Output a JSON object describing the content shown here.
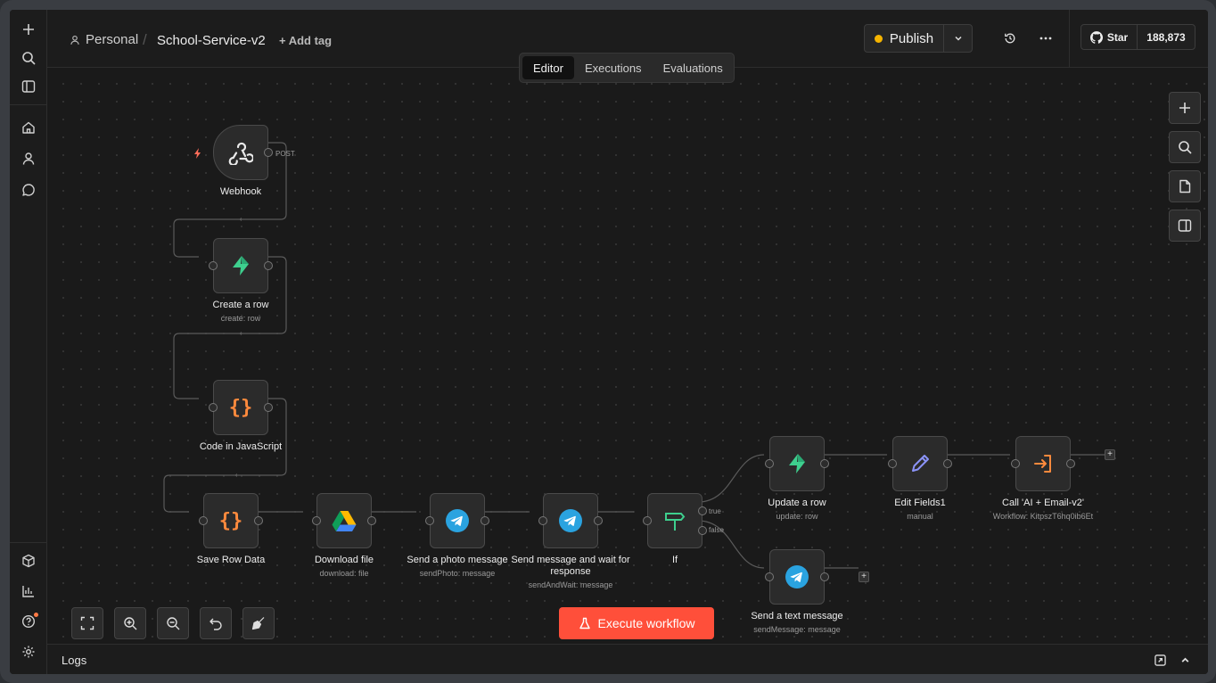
{
  "header": {
    "project": "Personal",
    "separator": "/",
    "workflow_name": "School-Service-v2",
    "add_tag": "+ Add tag",
    "publish_label": "Publish",
    "publish_status_color": "#f5b400",
    "github_star_label": "Star",
    "github_star_count": "188,873"
  },
  "tabs": [
    {
      "label": "Editor",
      "active": true
    },
    {
      "label": "Executions",
      "active": false
    },
    {
      "label": "Evaluations",
      "active": false
    }
  ],
  "nodes": {
    "webhook": {
      "label": "Webhook",
      "output": "POST",
      "icon": "webhook-icon"
    },
    "create_row": {
      "label": "Create a row",
      "sub": "create: row",
      "icon": "supabase-icon"
    },
    "code_js": {
      "label": "Code in JavaScript",
      "icon": "code-braces-icon"
    },
    "save_row": {
      "label": "Save Row Data",
      "icon": "code-braces-icon"
    },
    "download_file": {
      "label": "Download file",
      "sub": "download: file",
      "icon": "google-drive-icon"
    },
    "send_photo": {
      "label": "Send a photo message",
      "sub": "sendPhoto: message",
      "icon": "telegram-icon"
    },
    "send_wait": {
      "label": "Send message and wait for response",
      "sub": "sendAndWait: message",
      "icon": "telegram-icon"
    },
    "if": {
      "label": "If",
      "true_label": "true",
      "false_label": "false",
      "icon": "signpost-icon"
    },
    "update_row": {
      "label": "Update a row",
      "sub": "update: row",
      "icon": "supabase-icon"
    },
    "edit_fields": {
      "label": "Edit Fields1",
      "sub": "manual",
      "icon": "pencil-icon"
    },
    "call_workflow": {
      "label": "Call 'AI + Email-v2'",
      "sub": "Workflow: KitpszT6hq0ib6Et",
      "icon": "enter-arrow-icon"
    },
    "send_text": {
      "label": "Send a text message",
      "sub": "sendMessage: message",
      "icon": "telegram-icon"
    }
  },
  "canvas": {
    "execute_label": "Execute workflow",
    "accent_color": "#ff4f3a",
    "plus": "+"
  },
  "logs": {
    "label": "Logs"
  }
}
